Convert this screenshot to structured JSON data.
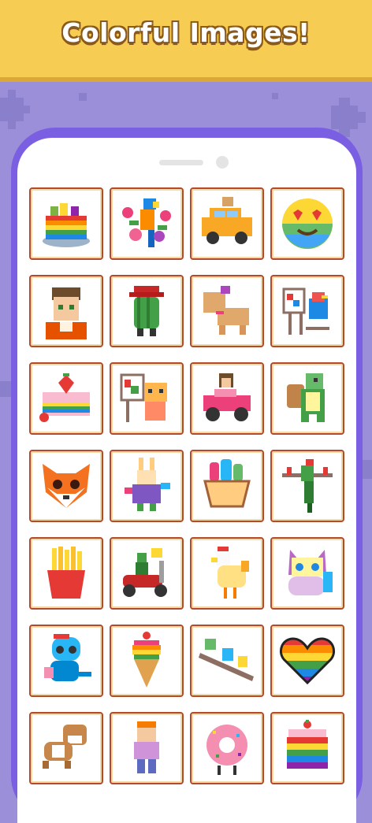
{
  "banner": {
    "title": "Colorful Images!"
  },
  "colors": {
    "banner": "#f6cc52",
    "background": "#9a8fd8",
    "phone": "#7b5fe3",
    "tile_border": "#b54a2a"
  },
  "gallery": {
    "items": [
      {
        "icon": "rainbow-cake-icon"
      },
      {
        "icon": "parrot-flowers-icon"
      },
      {
        "icon": "dog-in-car-icon"
      },
      {
        "icon": "heart-eyes-emoji-icon"
      },
      {
        "icon": "boy-portrait-icon"
      },
      {
        "icon": "cactus-hat-icon"
      },
      {
        "icon": "puppy-bow-icon"
      },
      {
        "icon": "bird-painter-icon"
      },
      {
        "icon": "strawberry-cake-icon"
      },
      {
        "icon": "cat-painter-icon"
      },
      {
        "icon": "girl-in-car-icon"
      },
      {
        "icon": "turtle-backpack-icon"
      },
      {
        "icon": "fox-face-icon"
      },
      {
        "icon": "rainbow-bunny-icon"
      },
      {
        "icon": "ice-cream-cup-icon"
      },
      {
        "icon": "parrot-branch-icon"
      },
      {
        "icon": "french-fries-icon"
      },
      {
        "icon": "scooter-rider-icon"
      },
      {
        "icon": "chicken-icon"
      },
      {
        "icon": "rainbow-cat-icon"
      },
      {
        "icon": "baby-dinosaur-icon"
      },
      {
        "icon": "ice-cream-cone-icon"
      },
      {
        "icon": "birds-on-branch-icon"
      },
      {
        "icon": "rainbow-heart-icon"
      },
      {
        "icon": "bulldog-running-icon"
      },
      {
        "icon": "boy-standing-icon"
      },
      {
        "icon": "donut-character-icon"
      },
      {
        "icon": "rainbow-cupcake-icon"
      }
    ]
  }
}
